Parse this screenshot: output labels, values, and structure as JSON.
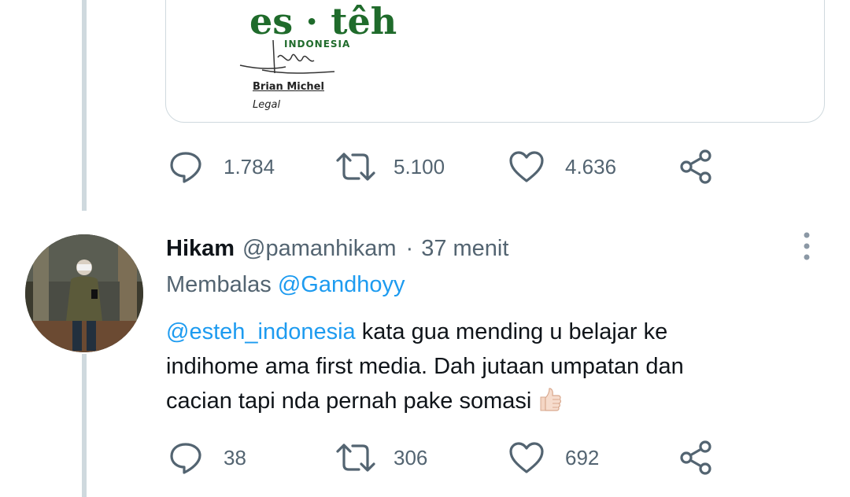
{
  "original_tweet": {
    "attachment": {
      "logo_text": "es · têh",
      "logo_subtext": "INDONESIA",
      "signatory_name": "Brian Michel",
      "signatory_role": "Legal"
    },
    "actions": {
      "replies": "1.784",
      "retweets": "5.100",
      "likes": "4.636"
    }
  },
  "reply_tweet": {
    "display_name": "Hikam",
    "handle": "@pamanhikam",
    "separator": "·",
    "time": "37 menit",
    "replying_to_label": "Membalas",
    "replying_to_handle": "@Gandhoyy",
    "mention": "@esteh_indonesia",
    "text_line1": " kata gua mending u belajar ke",
    "text_line2": "indihome ama first media. Dah jutaan umpatan dan",
    "text_line3": "cacian tapi nda pernah pake somasi",
    "emoji": "thumbs-up-emoji",
    "actions": {
      "replies": "38",
      "retweets": "306",
      "likes": "692"
    }
  },
  "colors": {
    "link": "#1d9bf0",
    "secondary_text": "#536471",
    "primary_text": "#0f1419",
    "thread_line": "#cfd9de",
    "logo_green": "#1f6b2b"
  }
}
